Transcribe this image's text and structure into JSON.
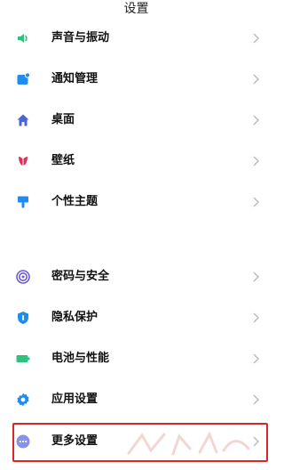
{
  "header": {
    "title": "设置"
  },
  "group1": [
    {
      "label": "声音与振动",
      "icon": "speaker-icon",
      "color": "#2ec27e"
    },
    {
      "label": "通知管理",
      "icon": "notification-icon",
      "color": "#1e8cf0"
    },
    {
      "label": "桌面",
      "icon": "home-icon",
      "color": "#4a63d8"
    },
    {
      "label": "壁纸",
      "icon": "flower-icon",
      "color": "#e0305a"
    },
    {
      "label": "个性主题",
      "icon": "brush-icon",
      "color": "#1e8cf0"
    }
  ],
  "group2": [
    {
      "label": "密码与安全",
      "icon": "fingerprint-icon",
      "color": "#6a5bd8"
    },
    {
      "label": "隐私保护",
      "icon": "privacy-shield-icon",
      "color": "#1e8cf0"
    },
    {
      "label": "电池与性能",
      "icon": "battery-icon",
      "color": "#2ec27e"
    },
    {
      "label": "应用设置",
      "icon": "gear-icon",
      "color": "#1e8cf0"
    },
    {
      "label": "更多设置",
      "icon": "more-dots-icon",
      "color": "#8a92e8"
    }
  ],
  "colors": {
    "highlight": "#d9262b",
    "chevron": "#b9b9b9"
  }
}
